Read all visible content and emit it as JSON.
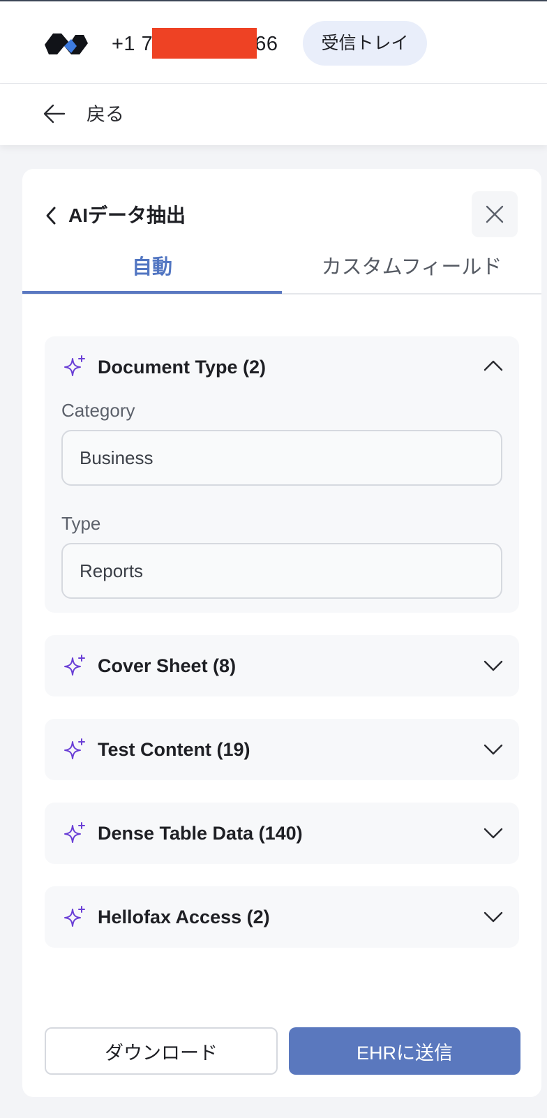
{
  "header": {
    "phone_prefix": "+1 7",
    "phone_suffix": "66",
    "inbox_label": "受信トレイ"
  },
  "nav": {
    "back_label": "戻る"
  },
  "panel": {
    "title": "AIデータ抽出",
    "tabs": [
      {
        "label": "自動",
        "active": true
      },
      {
        "label": "カスタムフィールド",
        "active": false
      }
    ],
    "sections": [
      {
        "title": "Document Type (2)",
        "expanded": true,
        "fields": [
          {
            "label": "Category",
            "value": "Business"
          },
          {
            "label": "Type",
            "value": "Reports"
          }
        ]
      },
      {
        "title": "Cover Sheet (8)",
        "expanded": false
      },
      {
        "title": "Test Content (19)",
        "expanded": false
      },
      {
        "title": "Dense Table Data (140)",
        "expanded": false
      },
      {
        "title": "Hellofax Access (2)",
        "expanded": false
      }
    ],
    "download_label": "ダウンロード",
    "send_label": "EHRに送信"
  },
  "colors": {
    "accent": "#5a78be",
    "sparkle": "#6a3fd6",
    "redaction": "#ee4224"
  },
  "icons": [
    "app-logo-icon",
    "arrow-left-icon",
    "chevron-left-icon",
    "close-icon",
    "sparkle-icon",
    "chevron-up-icon",
    "chevron-down-icon"
  ]
}
